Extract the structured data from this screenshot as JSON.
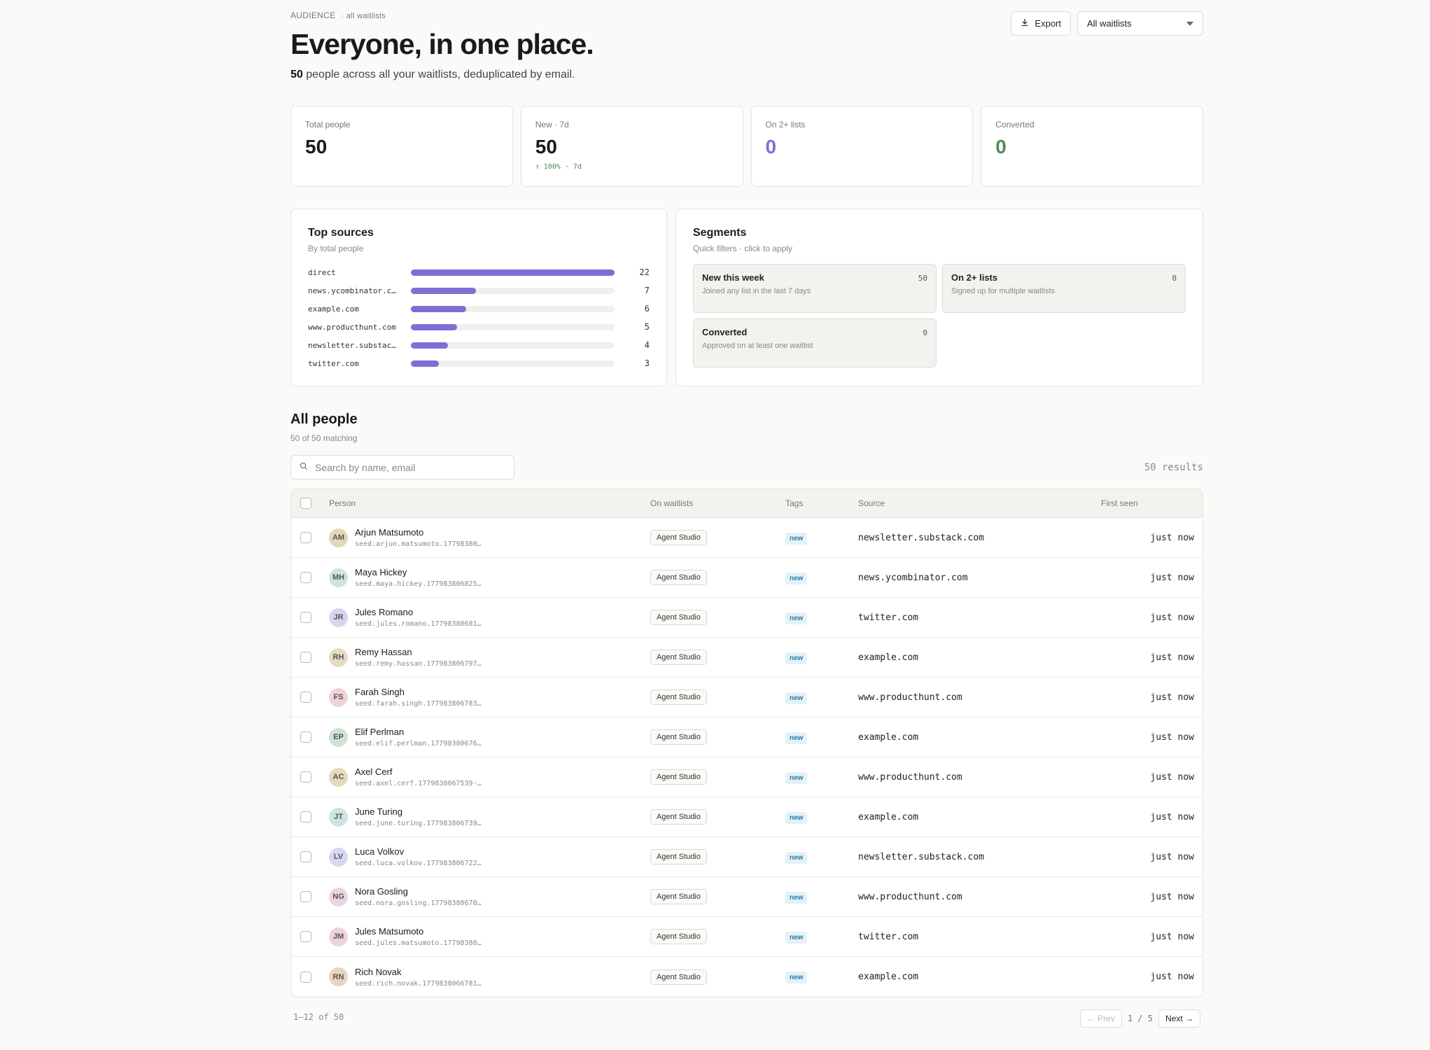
{
  "header": {
    "eyebrow": "AUDIENCE",
    "eyebrow_sub": "· all waitlists",
    "title": "Everyone, in one place.",
    "subtitle_count": "50",
    "subtitle_text": " people across all your waitlists, deduplicated by email.",
    "export_label": "Export",
    "waitlist_select": "All waitlists"
  },
  "stats": [
    {
      "label": "Total people",
      "value": "50"
    },
    {
      "label": "New · 7d",
      "value": "50",
      "delta": "↑ 100% · 7d"
    },
    {
      "label": "On 2+ lists",
      "value": "0"
    },
    {
      "label": "Converted",
      "value": "0"
    }
  ],
  "top_sources": {
    "title": "Top sources",
    "subtitle": "By total people",
    "max": 22,
    "items": [
      {
        "name": "direct",
        "count": 22
      },
      {
        "name": "news.ycombinator.c…",
        "count": 7
      },
      {
        "name": "example.com",
        "count": 6
      },
      {
        "name": "www.producthunt.com",
        "count": 5
      },
      {
        "name": "newsletter.substac…",
        "count": 4
      },
      {
        "name": "twitter.com",
        "count": 3
      }
    ]
  },
  "segments": {
    "title": "Segments",
    "subtitle": "Quick filters · click to apply",
    "items": [
      {
        "title": "New this week",
        "desc": "Joined any list in the last 7 days",
        "count": "50"
      },
      {
        "title": "On 2+ lists",
        "desc": "Signed up for multiple waitlists",
        "count": "0"
      },
      {
        "title": "Converted",
        "desc": "Approved on at least one waitlist",
        "count": "0"
      }
    ]
  },
  "people": {
    "title": "All people",
    "subtitle": "50 of 50 matching",
    "search_placeholder": "Search by name, email",
    "results": "50 results",
    "columns": [
      "Person",
      "On waitlists",
      "Tags",
      "Source",
      "First seen"
    ],
    "rows": [
      {
        "initials": "AM",
        "avatar": "#e4d6b8",
        "name": "Arjun Matsumoto",
        "email": "seed.arjun.matsumoto.17798380…",
        "waitlist": "Agent Studio",
        "tag": "new",
        "source": "newsletter.substack.com",
        "seen": "just now"
      },
      {
        "initials": "MH",
        "avatar": "#cfe3df",
        "name": "Maya Hickey",
        "email": "seed.maya.hickey.177983806825…",
        "waitlist": "Agent Studio",
        "tag": "new",
        "source": "news.ycombinator.com",
        "seen": "just now"
      },
      {
        "initials": "JR",
        "avatar": "#d6d6ef",
        "name": "Jules Romano",
        "email": "seed.jules.romano.17798380681…",
        "waitlist": "Agent Studio",
        "tag": "new",
        "source": "twitter.com",
        "seen": "just now"
      },
      {
        "initials": "RH",
        "avatar": "#e4dcc0",
        "name": "Remy Hassan",
        "email": "seed.remy.hassan.177983806797…",
        "waitlist": "Agent Studio",
        "tag": "new",
        "source": "example.com",
        "seen": "just now"
      },
      {
        "initials": "FS",
        "avatar": "#efd3d6",
        "name": "Farah Singh",
        "email": "seed.farah.singh.177983806783…",
        "waitlist": "Agent Studio",
        "tag": "new",
        "source": "www.producthunt.com",
        "seen": "just now"
      },
      {
        "initials": "EP",
        "avatar": "#cfe3d2",
        "name": "Elif Perlman",
        "email": "seed.elif.perlman.17798380676…",
        "waitlist": "Agent Studio",
        "tag": "new",
        "source": "example.com",
        "seen": "just now"
      },
      {
        "initials": "AC",
        "avatar": "#e4dcb8",
        "name": "Axel Cerf",
        "email": "seed.axel.cerf.1779838067539-…",
        "waitlist": "Agent Studio",
        "tag": "new",
        "source": "www.producthunt.com",
        "seen": "just now"
      },
      {
        "initials": "JT",
        "avatar": "#cfe3e5",
        "name": "June Turing",
        "email": "seed.june.turing.177983806739…",
        "waitlist": "Agent Studio",
        "tag": "new",
        "source": "example.com",
        "seen": "just now"
      },
      {
        "initials": "LV",
        "avatar": "#d6d8ef",
        "name": "Luca Volkov",
        "email": "seed.luca.volkov.177983806722…",
        "waitlist": "Agent Studio",
        "tag": "new",
        "source": "newsletter.substack.com",
        "seen": "just now"
      },
      {
        "initials": "NG",
        "avatar": "#ead4e4",
        "name": "Nora Gosling",
        "email": "seed.nora.gosling.17798380670…",
        "waitlist": "Agent Studio",
        "tag": "new",
        "source": "www.producthunt.com",
        "seen": "just now"
      },
      {
        "initials": "JM",
        "avatar": "#ecd3da",
        "name": "Jules Matsumoto",
        "email": "seed.jules.matsumoto.17798380…",
        "waitlist": "Agent Studio",
        "tag": "new",
        "source": "twitter.com",
        "seen": "just now"
      },
      {
        "initials": "RN",
        "avatar": "#e8d4c0",
        "name": "Rich Novak",
        "email": "seed.rich.novak.1779838066781…",
        "waitlist": "Agent Studio",
        "tag": "new",
        "source": "example.com",
        "seen": "just now"
      }
    ]
  },
  "pagination": {
    "range": "1–12 of 50",
    "prev": "← Prev",
    "page": "1 / 5",
    "next": "Next →"
  }
}
